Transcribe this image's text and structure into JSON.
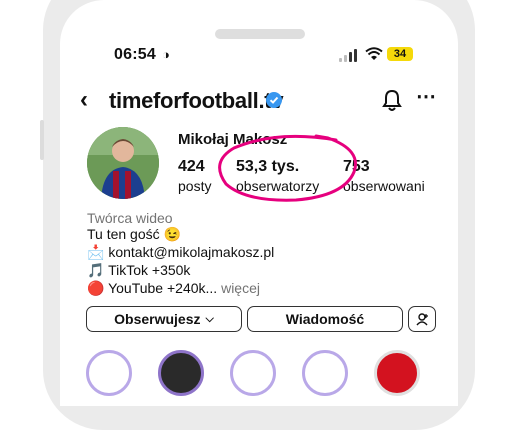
{
  "status_bar": {
    "time": "06:54",
    "battery": "34"
  },
  "header": {
    "username": "timeforfootball.tv"
  },
  "profile": {
    "name": "Mikołaj Makosz",
    "stats": [
      {
        "value": "424",
        "label": "posty"
      },
      {
        "value": "53,3 tys.",
        "label": "obserwatorzy"
      },
      {
        "value": "753",
        "label": "obserwowani"
      }
    ],
    "category": "Twórca wideo",
    "bio": [
      {
        "emoji": "",
        "text": "Tu ten gość 😉"
      },
      {
        "emoji": "📩",
        "text": "kontakt@mikolajmakosz.pl"
      },
      {
        "emoji": "🎵",
        "text": "TikTok +350k"
      },
      {
        "emoji": "🔴",
        "text": "YouTube +240k...",
        "more": "więcej"
      }
    ]
  },
  "actions": {
    "follow_label": "Obserwujesz",
    "message_label": "Wiadomość"
  },
  "colors": {
    "highlight_ring": "#e6007e",
    "verified": "#3897f0"
  }
}
